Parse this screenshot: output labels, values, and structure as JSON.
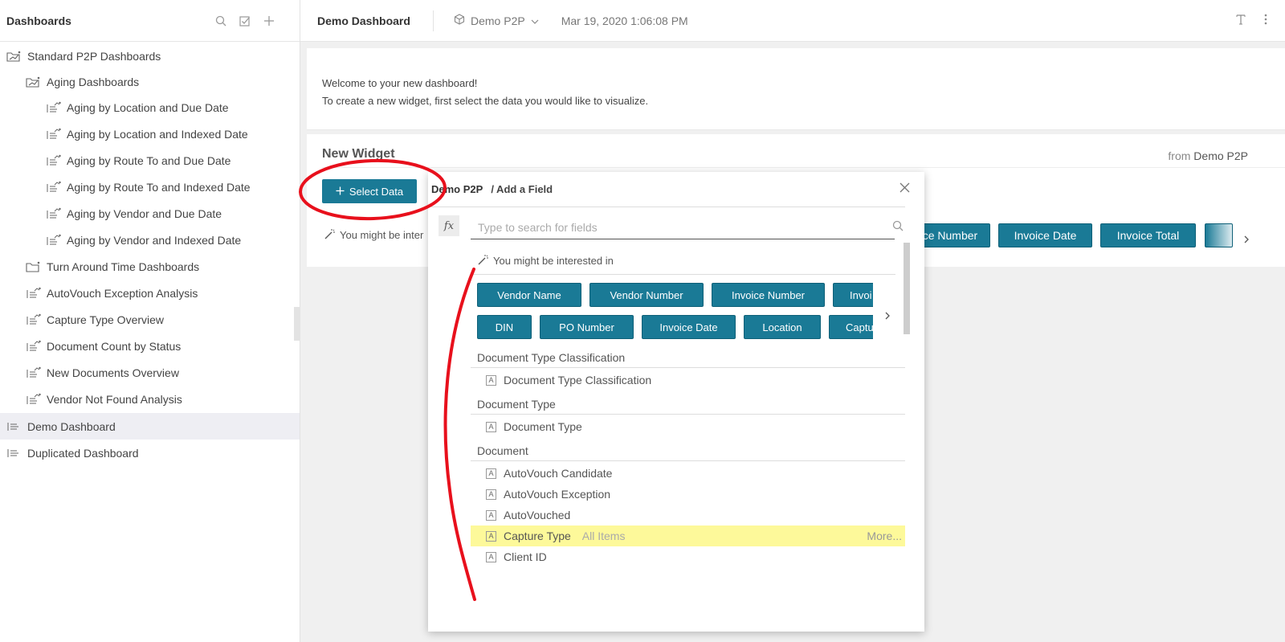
{
  "sidebar": {
    "title": "Dashboards",
    "items": [
      {
        "label": "Standard P2P Dashboards",
        "icon": "folder-chart-icon"
      },
      {
        "label": "Aging Dashboards",
        "icon": "folder-chart-icon"
      },
      {
        "label": "Aging by Location and Due Date",
        "icon": "dashboard-chart-icon"
      },
      {
        "label": "Aging by Location and Indexed Date",
        "icon": "dashboard-chart-icon"
      },
      {
        "label": "Aging by Route To and Due Date",
        "icon": "dashboard-chart-icon"
      },
      {
        "label": "Aging by Route To and Indexed Date",
        "icon": "dashboard-chart-icon"
      },
      {
        "label": "Aging by Vendor and Due Date",
        "icon": "dashboard-chart-icon"
      },
      {
        "label": "Aging by Vendor and Indexed Date",
        "icon": "dashboard-chart-icon"
      },
      {
        "label": "Turn Around Time Dashboards",
        "icon": "folder-chart-icon"
      },
      {
        "label": "AutoVouch Exception Analysis",
        "icon": "dashboard-chart-icon"
      },
      {
        "label": "Capture Type Overview",
        "icon": "dashboard-chart-icon"
      },
      {
        "label": "Document Count by Status",
        "icon": "dashboard-chart-icon"
      },
      {
        "label": "New Documents Overview",
        "icon": "dashboard-chart-icon"
      },
      {
        "label": "Vendor Not Found Analysis",
        "icon": "dashboard-chart-icon"
      },
      {
        "label": "Demo Dashboard",
        "icon": "dashboard-list-icon"
      },
      {
        "label": "Duplicated Dashboard",
        "icon": "dashboard-list-icon"
      }
    ]
  },
  "topbar": {
    "dashboard_name": "Demo Dashboard",
    "source": "Demo P2P",
    "date": "Mar 19, 2020 1:06:08 PM"
  },
  "welcome": {
    "line1": "Welcome to your new dashboard!",
    "line2": "To create a new widget, first select the data you would like to visualize."
  },
  "widget": {
    "title": "New Widget",
    "from_label": "from",
    "from_source": "Demo P2P",
    "select_label": "Select Data",
    "hint": "You might be inter",
    "chips": [
      "oice Number",
      "Invoice Date",
      "Invoice Total",
      ""
    ]
  },
  "popup": {
    "source": "Demo P2P",
    "path": "/ Add a Field",
    "fx": "fx",
    "search_placeholder": "Type to search for fields",
    "hint": "You might be interested in",
    "chips_row1": [
      "Vendor Name",
      "Vendor Number",
      "Invoice Number",
      "Invoi"
    ],
    "chips_row2": [
      "DIN",
      "PO Number",
      "Invoice Date",
      "Location",
      "Captu"
    ],
    "groups": [
      {
        "title": "Document Type Classification",
        "fields": [
          "Document Type Classification"
        ]
      },
      {
        "title": "Document Type",
        "fields": [
          "Document Type"
        ]
      },
      {
        "title": "Document",
        "fields": [
          "AutoVouch Candidate",
          "AutoVouch Exception",
          "AutoVouched",
          "Capture Type",
          "Client ID"
        ]
      }
    ],
    "highlight_sub": "All Items",
    "highlight_more": "More..."
  },
  "colors": {
    "accent": "#1a7a96",
    "highlight": "#fdf99a",
    "annotation": "#e8101c"
  }
}
